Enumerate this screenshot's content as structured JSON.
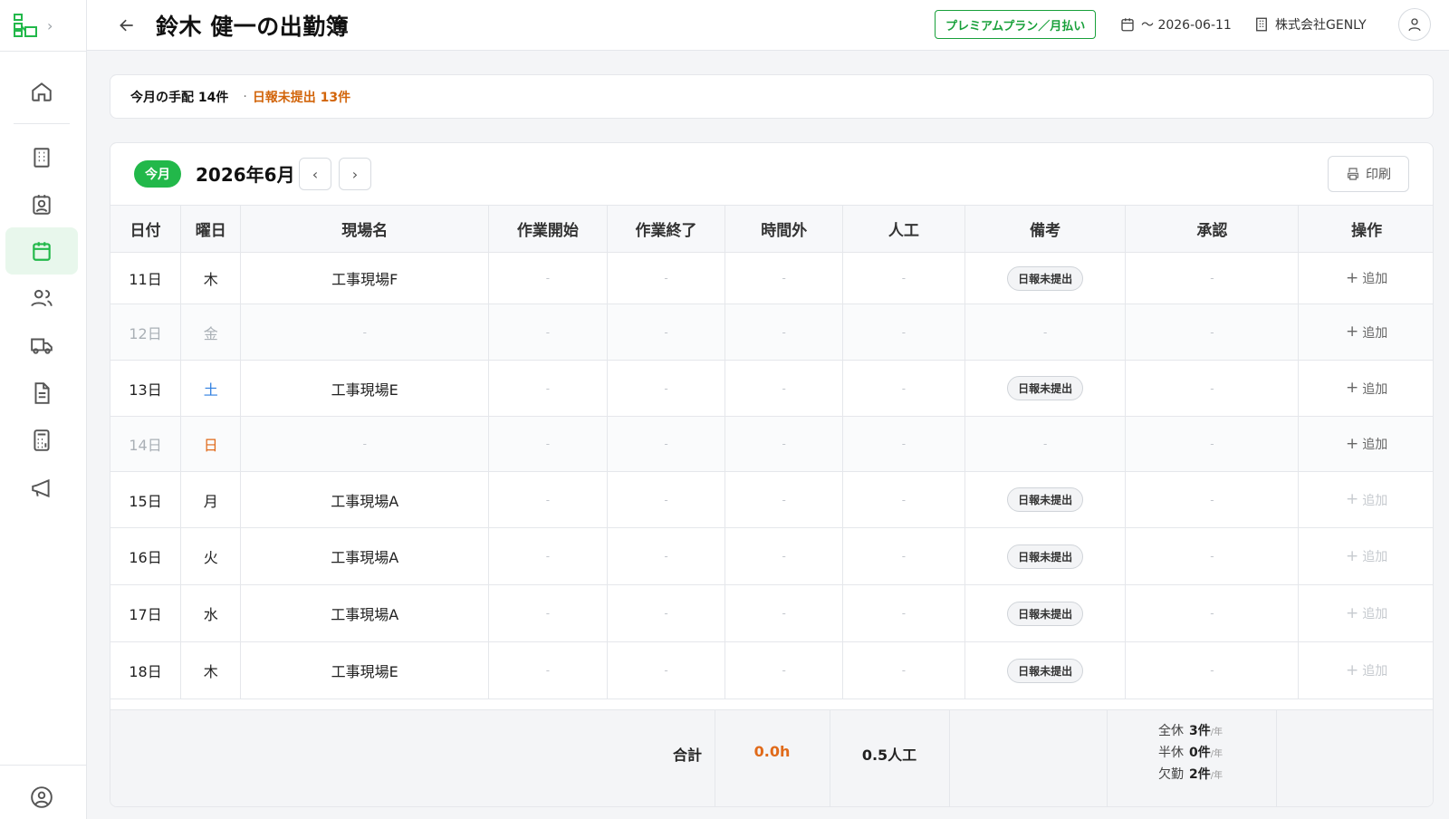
{
  "header": {
    "title": "鈴木 健一の出勤簿",
    "plan_badge": "プレミアムプラン／月払い",
    "date_range": "〜 2026-06-11",
    "company": "株式会社GENLY"
  },
  "summary": {
    "arrangements": "今月の手配 14件",
    "unsubmitted": "日報未提出 13件"
  },
  "toolbar": {
    "today": "今月",
    "month": "2026年6月",
    "print": "印刷"
  },
  "table": {
    "columns": [
      "日付",
      "曜日",
      "現場名",
      "作業開始",
      "作業終了",
      "時間外",
      "人工",
      "備考",
      "承認",
      "操作"
    ],
    "rows": [
      {
        "day": "11日",
        "weekday": "木",
        "site": "工事現場F",
        "start": "-",
        "end": "-",
        "overtime": "-",
        "manday": "-",
        "note": "日報未提出",
        "approval": "-",
        "action": "追加"
      },
      {
        "day": "12日",
        "weekday": "金",
        "site": "-",
        "start": "-",
        "end": "-",
        "overtime": "-",
        "manday": "-",
        "note": "-",
        "approval": "-",
        "action": "追加"
      },
      {
        "day": "13日",
        "weekday": "土",
        "site": "工事現場E",
        "start": "-",
        "end": "-",
        "overtime": "-",
        "manday": "-",
        "note": "日報未提出",
        "approval": "-",
        "action": "追加"
      },
      {
        "day": "14日",
        "weekday": "日",
        "site": "-",
        "start": "-",
        "end": "-",
        "overtime": "-",
        "manday": "-",
        "note": "-",
        "approval": "-",
        "action": "追加"
      },
      {
        "day": "15日",
        "weekday": "月",
        "site": "工事現場A",
        "start": "-",
        "end": "-",
        "overtime": "-",
        "manday": "-",
        "note": "日報未提出",
        "approval": "-",
        "action": "追加"
      },
      {
        "day": "16日",
        "weekday": "火",
        "site": "工事現場A",
        "start": "-",
        "end": "-",
        "overtime": "-",
        "manday": "-",
        "note": "日報未提出",
        "approval": "-",
        "action": "追加"
      },
      {
        "day": "17日",
        "weekday": "水",
        "site": "工事現場A",
        "start": "-",
        "end": "-",
        "overtime": "-",
        "manday": "-",
        "note": "日報未提出",
        "approval": "-",
        "action": "追加"
      },
      {
        "day": "18日",
        "weekday": "木",
        "site": "工事現場E",
        "start": "-",
        "end": "-",
        "overtime": "-",
        "manday": "-",
        "note": "日報未提出",
        "approval": "-",
        "action": "追加"
      }
    ]
  },
  "footer": {
    "total_label": "合計",
    "overtime_total": "0.0h",
    "manday_total": "0.5人工",
    "leave": [
      {
        "label": "全休",
        "value": "3件",
        "unit": "/年"
      },
      {
        "label": "半休",
        "value": "0件",
        "unit": "/年"
      },
      {
        "label": "欠勤",
        "value": "2件",
        "unit": "/年"
      }
    ]
  },
  "colors": {
    "brand_green": "#22b84a",
    "warning_orange": "#d2650b",
    "saturday_blue": "#2f7fe0",
    "sunday_orange": "#e06a1a"
  }
}
